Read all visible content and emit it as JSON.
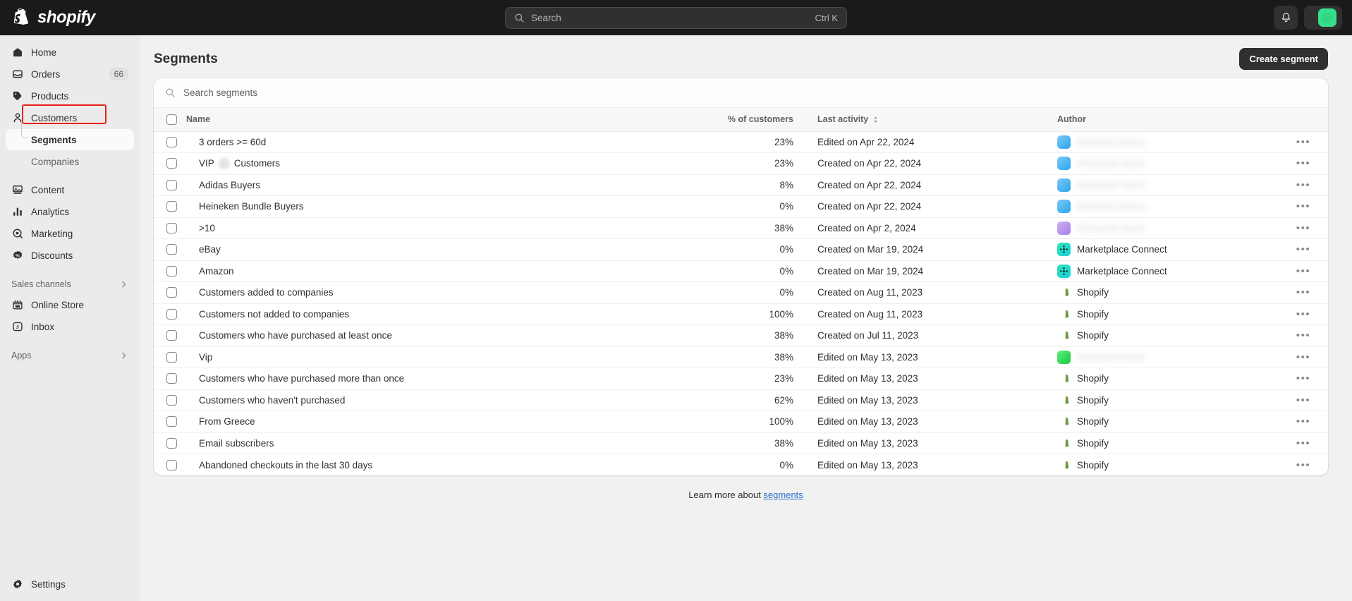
{
  "topbar": {
    "brand": "shopify",
    "brand_icon": "shopify-bag-icon",
    "search": {
      "placeholder": "Search",
      "value": "",
      "shortcut": "Ctrl K",
      "icon": "search-icon"
    },
    "notifications_icon": "bell-icon",
    "store_name": "",
    "avatar_color": "#34e18a"
  },
  "sidebar": {
    "items": [
      {
        "label": "Home",
        "icon": "home-icon",
        "badge": ""
      },
      {
        "label": "Orders",
        "icon": "orders-inbox-icon",
        "badge": "66"
      },
      {
        "label": "Products",
        "icon": "tag-icon",
        "badge": ""
      },
      {
        "label": "Customers",
        "icon": "person-icon",
        "badge": ""
      }
    ],
    "sub_items": [
      {
        "label": "Segments",
        "active": true
      },
      {
        "label": "Companies",
        "active": false
      }
    ],
    "items2": [
      {
        "label": "Content",
        "icon": "content-icon",
        "badge": ""
      },
      {
        "label": "Analytics",
        "icon": "bar-chart-icon",
        "badge": ""
      },
      {
        "label": "Marketing",
        "icon": "target-icon",
        "badge": ""
      },
      {
        "label": "Discounts",
        "icon": "discount-percent-icon",
        "badge": ""
      }
    ],
    "sales_channels": {
      "title": "Sales channels",
      "chevron": "chevron-right-icon"
    },
    "channels": [
      {
        "label": "Online Store",
        "icon": "storefront-icon"
      },
      {
        "label": "Inbox",
        "icon": "inbox-app-icon"
      }
    ],
    "apps": {
      "title": "Apps",
      "chevron": "chevron-right-icon"
    },
    "settings": {
      "label": "Settings",
      "icon": "gear-icon"
    }
  },
  "page": {
    "title": "Segments",
    "create_button": "Create segment",
    "search_placeholder": "Search segments",
    "search_value": "",
    "search_icon": "search-icon",
    "footer_prefix": "Learn more about ",
    "footer_link": "segments"
  },
  "table": {
    "columns": {
      "name": "Name",
      "percent": "% of customers",
      "last_activity": "Last activity",
      "sort_icon": "sort-updown-icon",
      "author": "Author",
      "menu_icon": "ellipsis-horizontal-icon"
    },
    "rows": [
      {
        "name": "3 orders >= 60d",
        "redacted_name": false,
        "percent": "23%",
        "activity": "Edited on Apr 22, 2024",
        "author": "",
        "author_blurred": true,
        "avatar": "blue"
      },
      {
        "name_pre": "VIP",
        "name_post": "Customers",
        "redacted_name": true,
        "percent": "23%",
        "activity": "Created on Apr 22, 2024",
        "author": "",
        "author_blurred": true,
        "avatar": "blue"
      },
      {
        "name": "Adidas Buyers",
        "redacted_name": false,
        "percent": "8%",
        "activity": "Created on Apr 22, 2024",
        "author": "",
        "author_blurred": true,
        "avatar": "blue"
      },
      {
        "name": "Heineken Bundle Buyers",
        "redacted_name": false,
        "percent": "0%",
        "activity": "Created on Apr 22, 2024",
        "author": "",
        "author_blurred": true,
        "avatar": "blue"
      },
      {
        "name": ">10",
        "redacted_name": false,
        "percent": "38%",
        "activity": "Created on Apr 2, 2024",
        "author": "",
        "author_blurred": true,
        "avatar": "purple"
      },
      {
        "name": "eBay",
        "redacted_name": false,
        "percent": "0%",
        "activity": "Created on Mar 19, 2024",
        "author": "Marketplace Connect",
        "author_blurred": false,
        "avatar": "teal"
      },
      {
        "name": "Amazon",
        "redacted_name": false,
        "percent": "0%",
        "activity": "Created on Mar 19, 2024",
        "author": "Marketplace Connect",
        "author_blurred": false,
        "avatar": "teal"
      },
      {
        "name": "Customers added to companies",
        "redacted_name": false,
        "percent": "0%",
        "activity": "Created on Aug 11, 2023",
        "author": "Shopify",
        "author_blurred": false,
        "avatar": "shopify"
      },
      {
        "name": "Customers not added to companies",
        "redacted_name": false,
        "percent": "100%",
        "activity": "Created on Aug 11, 2023",
        "author": "Shopify",
        "author_blurred": false,
        "avatar": "shopify"
      },
      {
        "name": "Customers who have purchased at least once",
        "redacted_name": false,
        "percent": "38%",
        "activity": "Created on Jul 11, 2023",
        "author": "Shopify",
        "author_blurred": false,
        "avatar": "shopify"
      },
      {
        "name": "Vip",
        "redacted_name": false,
        "percent": "38%",
        "activity": "Edited on May 13, 2023",
        "author": "",
        "author_blurred": true,
        "avatar": "green"
      },
      {
        "name": "Customers who have purchased more than once",
        "redacted_name": false,
        "percent": "23%",
        "activity": "Edited on May 13, 2023",
        "author": "Shopify",
        "author_blurred": false,
        "avatar": "shopify"
      },
      {
        "name": "Customers who haven't purchased",
        "redacted_name": false,
        "percent": "62%",
        "activity": "Edited on May 13, 2023",
        "author": "Shopify",
        "author_blurred": false,
        "avatar": "shopify"
      },
      {
        "name": "From Greece",
        "redacted_name": false,
        "percent": "100%",
        "activity": "Edited on May 13, 2023",
        "author": "Shopify",
        "author_blurred": false,
        "avatar": "shopify"
      },
      {
        "name": "Email subscribers",
        "redacted_name": false,
        "percent": "38%",
        "activity": "Edited on May 13, 2023",
        "author": "Shopify",
        "author_blurred": false,
        "avatar": "shopify"
      },
      {
        "name": "Abandoned checkouts in the last 30 days",
        "redacted_name": false,
        "percent": "0%",
        "activity": "Edited on May 13, 2023",
        "author": "Shopify",
        "author_blurred": false,
        "avatar": "shopify"
      }
    ]
  },
  "colors": {
    "topbar_bg": "#1a1a1a",
    "sidebar_bg": "#ebebeb",
    "main_bg": "#f1f1f1",
    "accent_link": "#2c6ecb",
    "highlight_box": "#e8231a",
    "avatar_green": "#34e18a"
  }
}
